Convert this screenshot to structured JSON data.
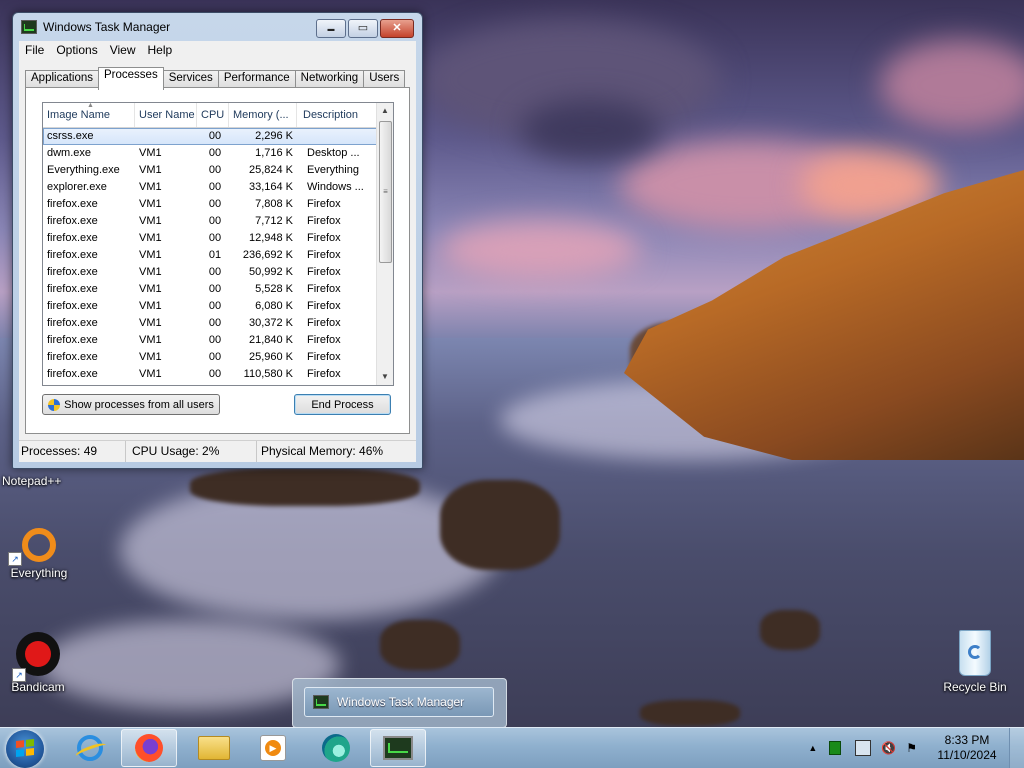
{
  "window": {
    "title": "Windows Task Manager",
    "caption_buttons": {
      "minimize": "▬",
      "maximize": "▭",
      "close": "✕"
    }
  },
  "menu": [
    "File",
    "Options",
    "View",
    "Help"
  ],
  "tabs": [
    "Applications",
    "Processes",
    "Services",
    "Performance",
    "Networking",
    "Users"
  ],
  "active_tab": "Processes",
  "process_table": {
    "columns": [
      "Image Name",
      "User Name",
      "CPU",
      "Memory (...",
      "Description"
    ],
    "rows": [
      [
        "csrss.exe",
        "",
        "00",
        "2,296 K",
        ""
      ],
      [
        "dwm.exe",
        "VM1",
        "00",
        "1,716 K",
        "Desktop ..."
      ],
      [
        "Everything.exe",
        "VM1",
        "00",
        "25,824 K",
        "Everything"
      ],
      [
        "explorer.exe",
        "VM1",
        "00",
        "33,164 K",
        "Windows ..."
      ],
      [
        "firefox.exe",
        "VM1",
        "00",
        "7,808 K",
        "Firefox"
      ],
      [
        "firefox.exe",
        "VM1",
        "00",
        "7,712 K",
        "Firefox"
      ],
      [
        "firefox.exe",
        "VM1",
        "00",
        "12,948 K",
        "Firefox"
      ],
      [
        "firefox.exe",
        "VM1",
        "01",
        "236,692 K",
        "Firefox"
      ],
      [
        "firefox.exe",
        "VM1",
        "00",
        "50,992 K",
        "Firefox"
      ],
      [
        "firefox.exe",
        "VM1",
        "00",
        "5,528 K",
        "Firefox"
      ],
      [
        "firefox.exe",
        "VM1",
        "00",
        "6,080 K",
        "Firefox"
      ],
      [
        "firefox.exe",
        "VM1",
        "00",
        "30,372 K",
        "Firefox"
      ],
      [
        "firefox.exe",
        "VM1",
        "00",
        "21,840 K",
        "Firefox"
      ],
      [
        "firefox.exe",
        "VM1",
        "00",
        "25,960 K",
        "Firefox"
      ],
      [
        "firefox.exe",
        "VM1",
        "00",
        "110,580 K",
        "Firefox"
      ]
    ]
  },
  "buttons": {
    "show_all": "Show processes from all users",
    "end_process": "End Process"
  },
  "status": {
    "processes": "Processes: 49",
    "cpu": "CPU Usage: 2%",
    "memory": "Physical Memory: 46%"
  },
  "desktop_icons": {
    "notepadpp": "Notepad++",
    "everything": "Everything",
    "bandicam": "Bandicam",
    "recycle_bin": "Recycle Bin"
  },
  "taskbar": {
    "thumbnail_title": "Windows Task Manager",
    "pinned": [
      "internet-explorer-icon",
      "firefox-icon",
      "file-explorer-icon",
      "media-player-icon",
      "edge-like-icon",
      "task-manager-icon"
    ],
    "clock_time": "8:33 PM",
    "clock_date": "11/10/2024"
  },
  "colors": {
    "selection": "#d5e5fa",
    "taskbar": "#8fb0ce",
    "close_button": "#c4432c"
  }
}
